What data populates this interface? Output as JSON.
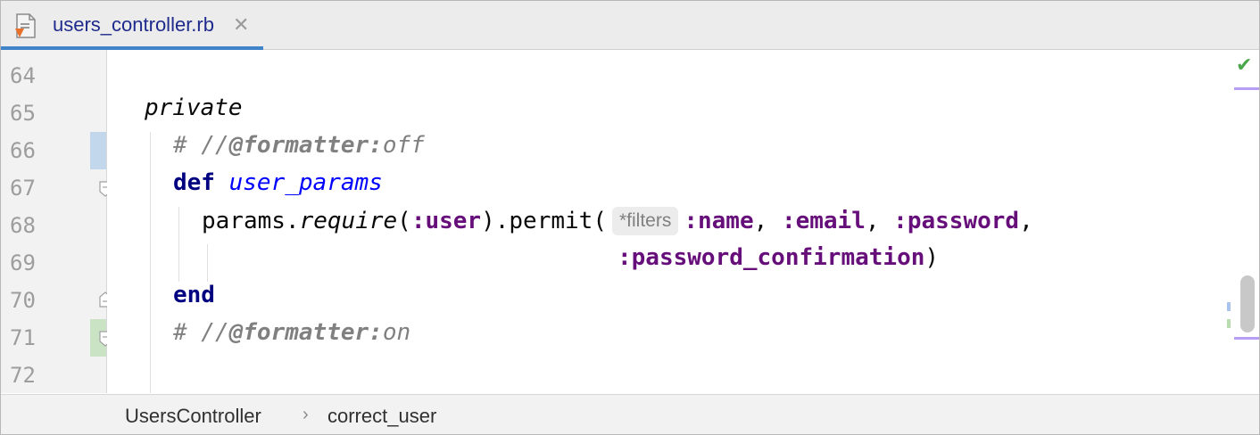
{
  "tab": {
    "file_name": "users_controller.rb",
    "close_glyph": "✕",
    "icon": "ruby-file-icon"
  },
  "gutter": {
    "line_numbers": [
      "64",
      "65",
      "66",
      "67",
      "68",
      "69",
      "70",
      "71",
      "72"
    ]
  },
  "code": {
    "l65": {
      "keyword": "private"
    },
    "l66": {
      "prefix": "# //",
      "tag": "@formatter:",
      "value": "off"
    },
    "l67": {
      "def": "def",
      "name": "user_params"
    },
    "l68": {
      "obj": "params.",
      "method": "require",
      "open": "(",
      "sym_user": ":user",
      "close_permit": ").permit(",
      "hint": "*filters",
      "sym_name": ":name",
      "comma1": ", ",
      "sym_email": ":email",
      "comma2": ", ",
      "sym_password": ":password",
      "comma3": ","
    },
    "l69": {
      "sym": ":password_confirmation",
      "close": ")"
    },
    "l70": {
      "end": "end"
    },
    "l71": {
      "prefix": "# //",
      "tag": "@formatter:",
      "value": "on"
    }
  },
  "inspection": {
    "status_icon": "check-icon",
    "glyph": "✔"
  },
  "breadcrumbs": {
    "items": [
      "UsersController",
      "correct_user"
    ],
    "separator": "›"
  },
  "colors": {
    "keyword": "#000080",
    "method_name": "#0000ff",
    "symbol": "#660e7a",
    "comment": "#808080",
    "tab_accent": "#4083c9"
  }
}
